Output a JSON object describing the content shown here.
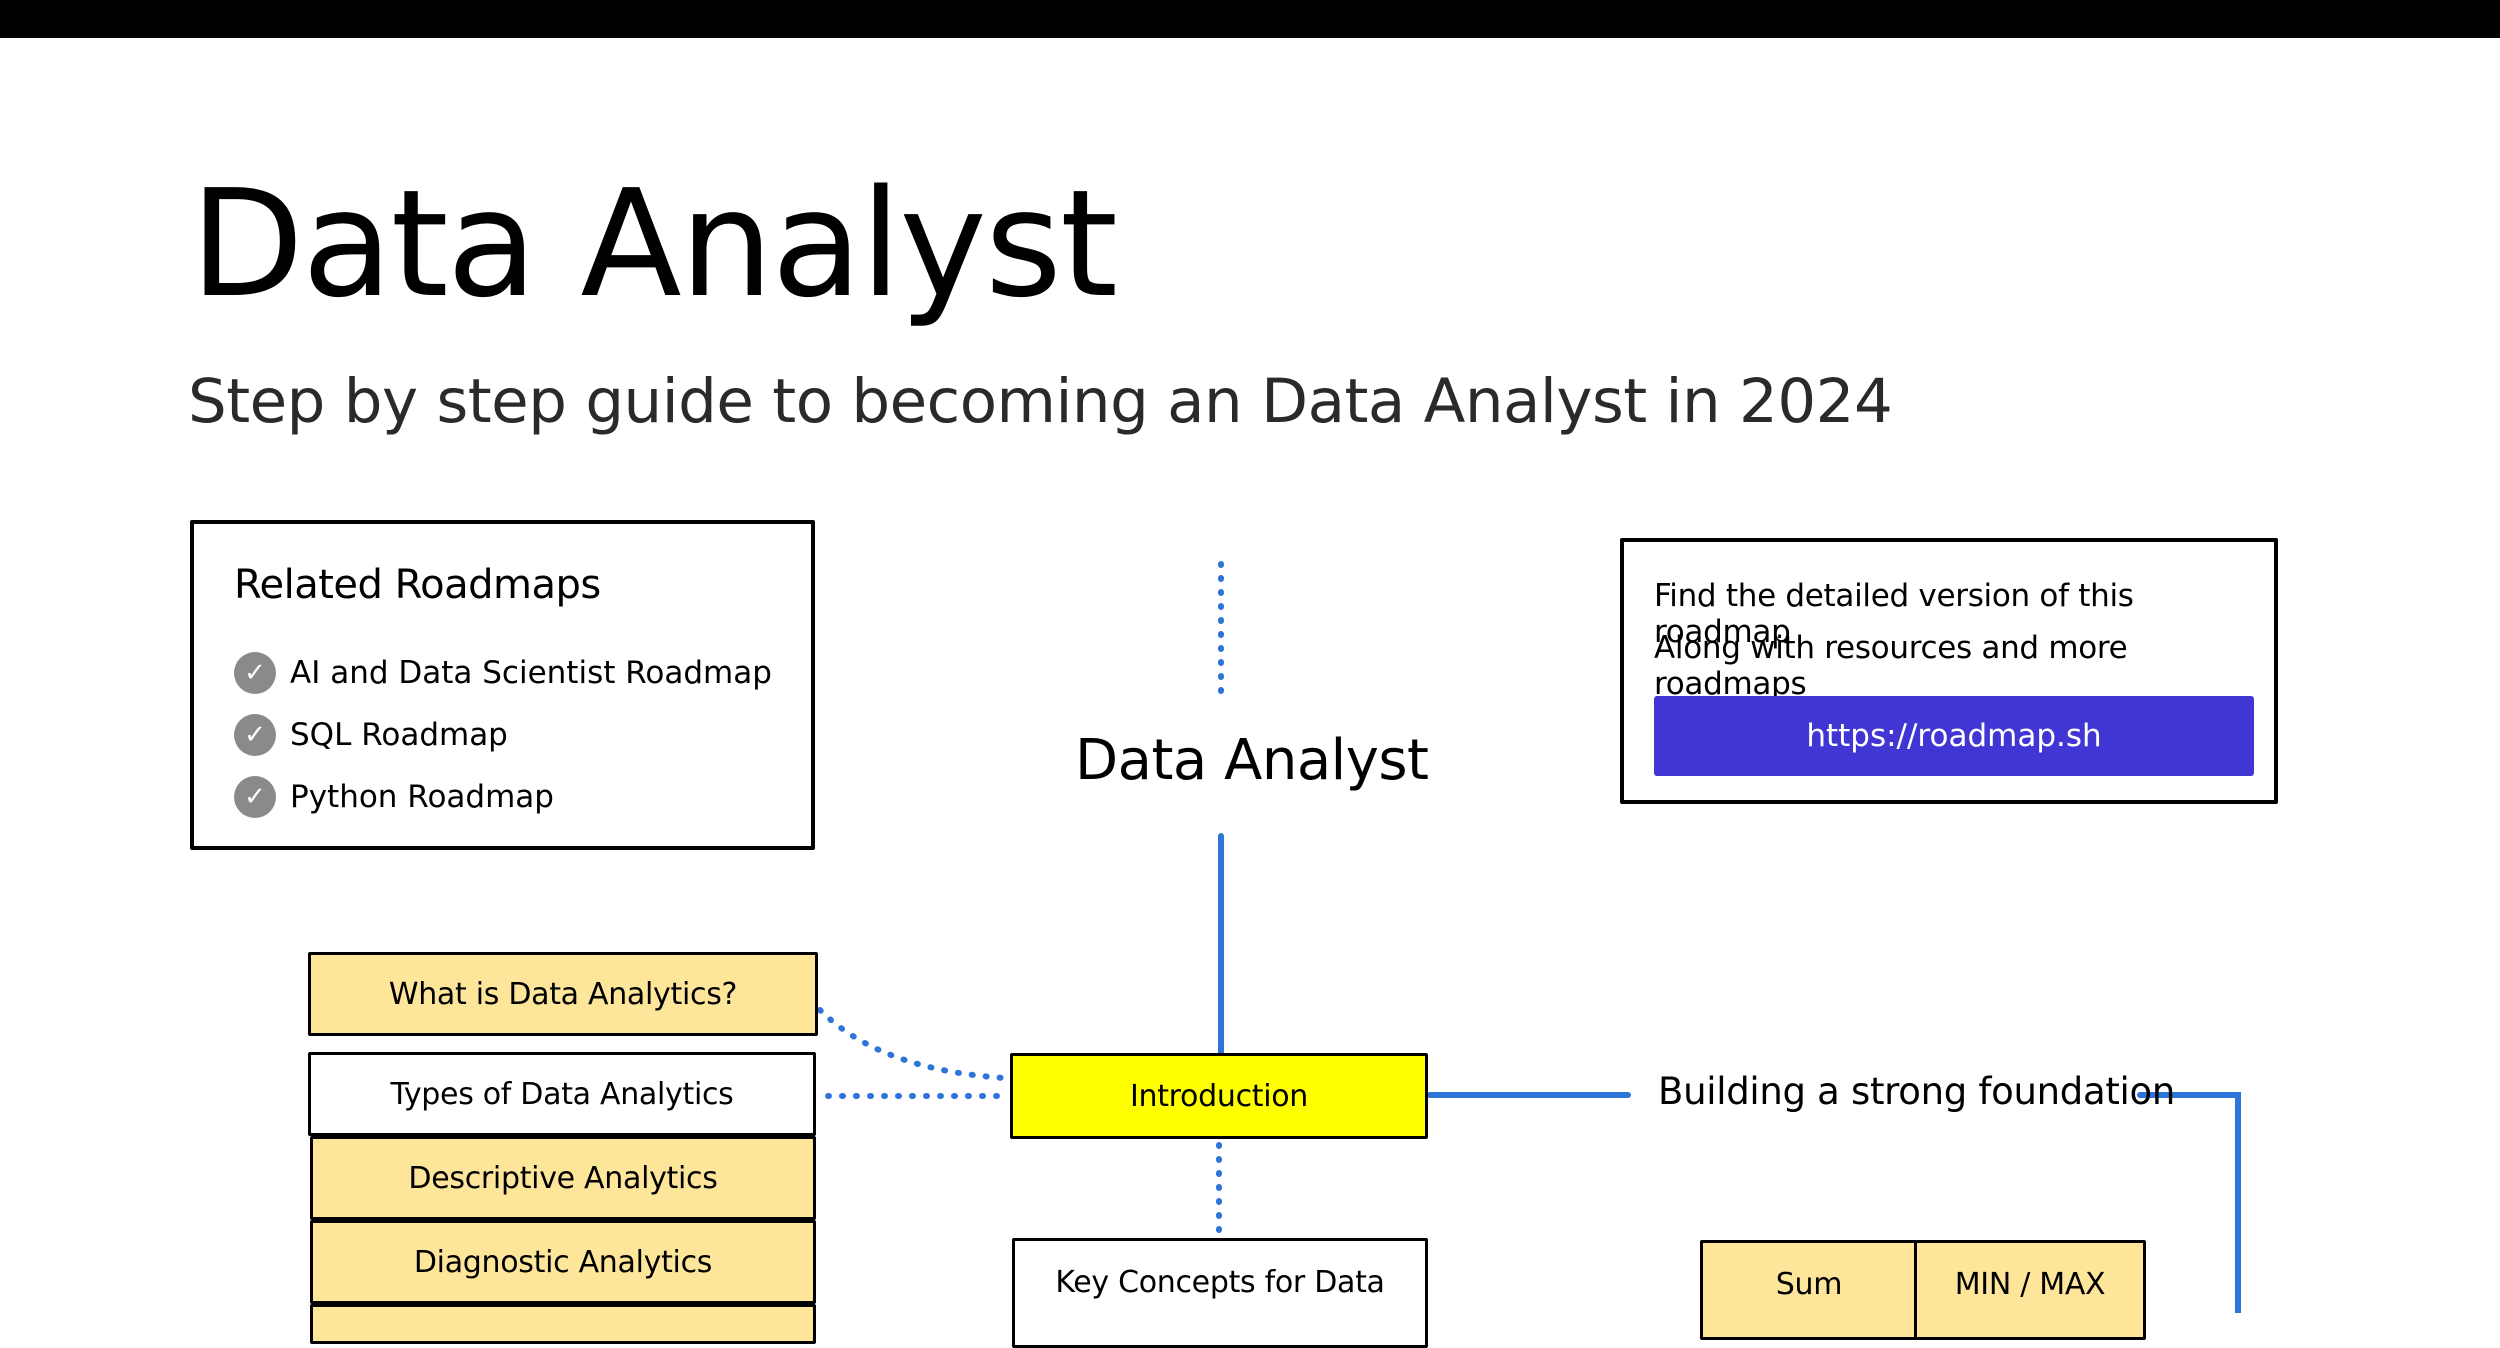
{
  "header": {
    "title": "Data Analyst",
    "subtitle": "Step by step guide to becoming an Data Analyst in 2024"
  },
  "related": {
    "heading": "Related Roadmaps",
    "items": [
      {
        "label": "AI and Data Scientist Roadmap",
        "icon": "check-circle-icon"
      },
      {
        "label": "SQL Roadmap",
        "icon": "check-circle-icon"
      },
      {
        "label": "Python Roadmap",
        "icon": "check-circle-icon"
      }
    ]
  },
  "promo": {
    "line1": "Find the detailed version of this roadmap",
    "line2": "Along with resources and more roadmaps",
    "link": "https://roadmap.sh",
    "button_color": "#4136d4"
  },
  "diagram": {
    "center_title": "Data Analyst",
    "introduction": "Introduction",
    "foundation_label": "Building a strong foundation",
    "key_concepts": "Key Concepts for Data",
    "intro_topics": [
      "What is Data Analytics?",
      "Types of Data Analytics",
      "Descriptive Analytics",
      "Diagnostic Analytics"
    ],
    "foundation_topics": [
      "Sum",
      "MIN / MAX"
    ],
    "colors": {
      "connector_blue": "#2f74d8",
      "topic_fill": "#fde59a",
      "highlight_fill": "#ffff00"
    }
  }
}
